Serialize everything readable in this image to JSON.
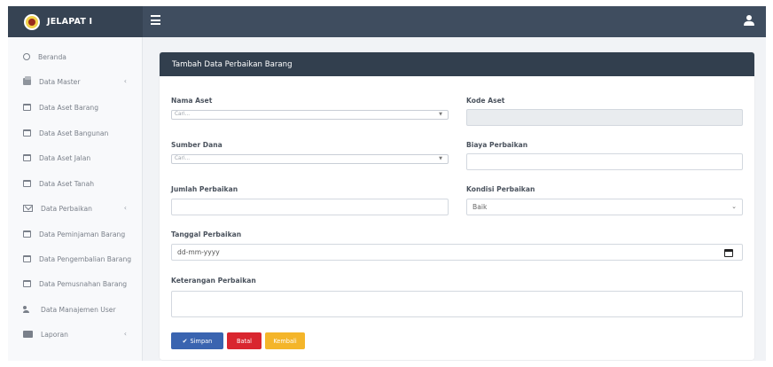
{
  "app": {
    "brand": "JELAPAT I"
  },
  "sidebar": {
    "items": [
      {
        "label": "Beranda",
        "icon": "dashboard-icon"
      },
      {
        "label": "Data Master",
        "icon": "folder-icon",
        "chevron": "‹"
      },
      {
        "label": "Data Aset Barang",
        "icon": "calendar-icon"
      },
      {
        "label": "Data Aset Bangunan",
        "icon": "calendar-icon"
      },
      {
        "label": "Data Aset Jalan",
        "icon": "calendar-icon"
      },
      {
        "label": "Data Aset Tanah",
        "icon": "calendar-icon"
      },
      {
        "label": "Data Perbaikan",
        "icon": "envelope-icon",
        "chevron": "‹"
      },
      {
        "label": "Data Peminjaman Barang",
        "icon": "calendar-icon"
      },
      {
        "label": "Data Pengembalian Barang",
        "icon": "calendar-icon"
      },
      {
        "label": "Data Pemusnahan Barang",
        "icon": "calendar-icon"
      },
      {
        "label": "Data Manajemen User",
        "icon": "users-icon"
      },
      {
        "label": "Laporan",
        "icon": "report-icon",
        "chevron": "‹"
      }
    ]
  },
  "form": {
    "title": "Tambah Data Perbaikan Barang",
    "nama_aset": {
      "label": "Nama Aset",
      "placeholder": "Cari..."
    },
    "kode_aset": {
      "label": "Kode Aset",
      "value": ""
    },
    "sumber_dana": {
      "label": "Sumber Dana",
      "placeholder": "Cari..."
    },
    "biaya_perbaikan": {
      "label": "Biaya Perbaikan",
      "value": ""
    },
    "jumlah_perbaikan": {
      "label": "Jumlah Perbaikan",
      "value": ""
    },
    "kondisi_perbaikan": {
      "label": "Kondisi Perbaikan",
      "selected": "Baik"
    },
    "tanggal_perbaikan": {
      "label": "Tanggal Perbaikan",
      "placeholder": "dd-mm-yyyy"
    },
    "keterangan_perbaikan": {
      "label": "Keterangan Perbaikan",
      "value": ""
    },
    "buttons": {
      "save": "Simpan",
      "cancel": "Batal",
      "back": "Kembali"
    }
  },
  "colors": {
    "topbar": "#3f4d5f",
    "card_header": "#323f4e",
    "save": "#3a64b0",
    "cancel": "#d9262f",
    "back": "#f4b52a"
  }
}
